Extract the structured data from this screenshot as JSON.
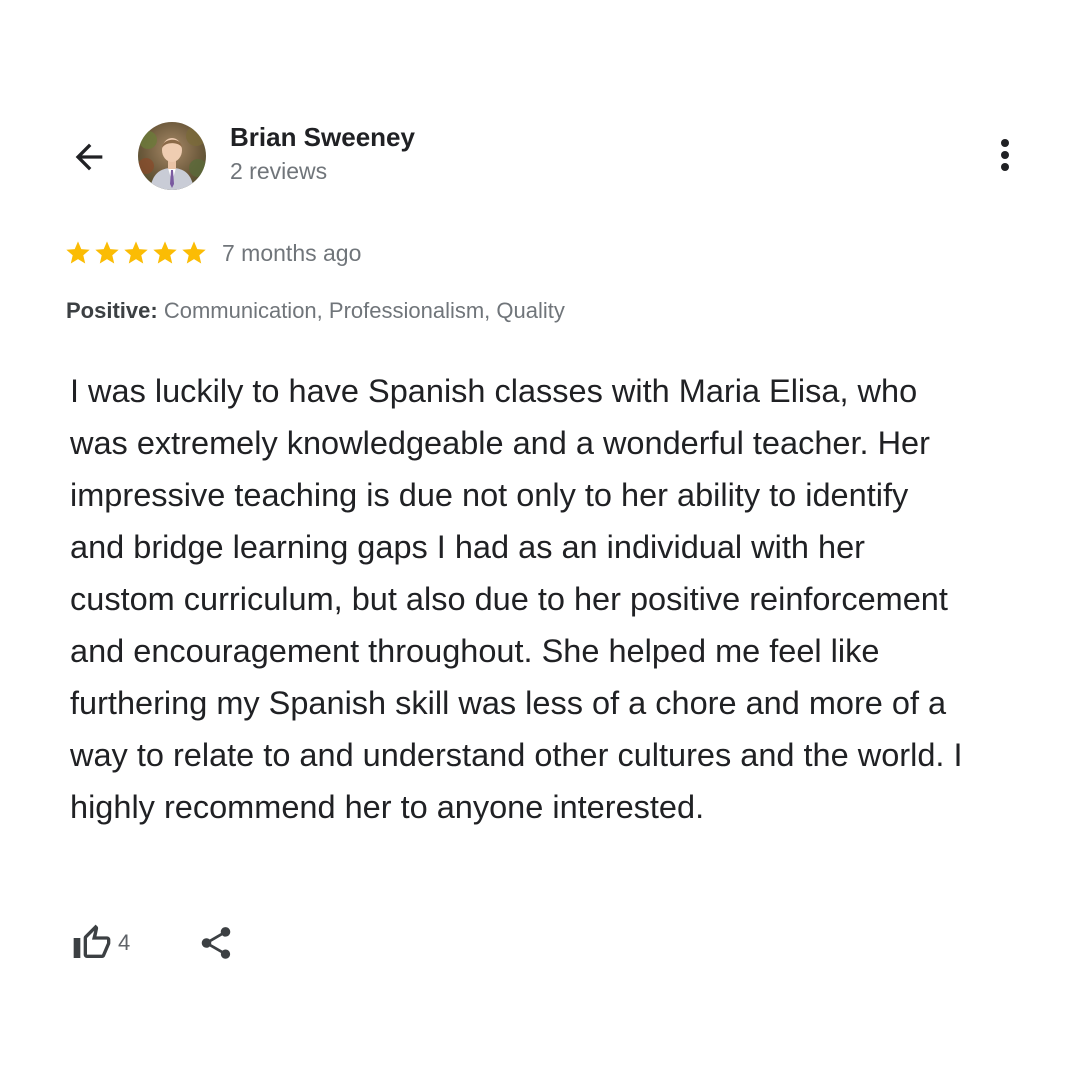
{
  "header": {
    "author_name": "Brian Sweeney",
    "author_reviews": "2 reviews",
    "back_icon": "arrow-back-icon",
    "more_icon": "more-vert-icon"
  },
  "review": {
    "rating": 5,
    "max_rating": 5,
    "date": "7 months ago",
    "positive_label": "Positive:",
    "positive_values": "Communication, Professionalism, Quality",
    "text": "I was luckily to have Spanish classes with Maria Elisa, who was extremely knowledgeable and a wonderful teacher. Her impressive teaching is due not only to her ability to identify and bridge learning gaps I had as an individual with her custom curriculum, but also due to her positive reinforcement and encouragement throughout. She helped me feel like furthering my Spanish skill was less of a chore and more of a way to relate to and understand other cultures and the world. I highly recommend her to anyone interested."
  },
  "actions": {
    "like_count": "4",
    "like_icon": "thumb-up-icon",
    "share_icon": "share-icon"
  },
  "colors": {
    "star": "#fbbc04",
    "text_primary": "#202124",
    "text_secondary": "#70757a"
  }
}
